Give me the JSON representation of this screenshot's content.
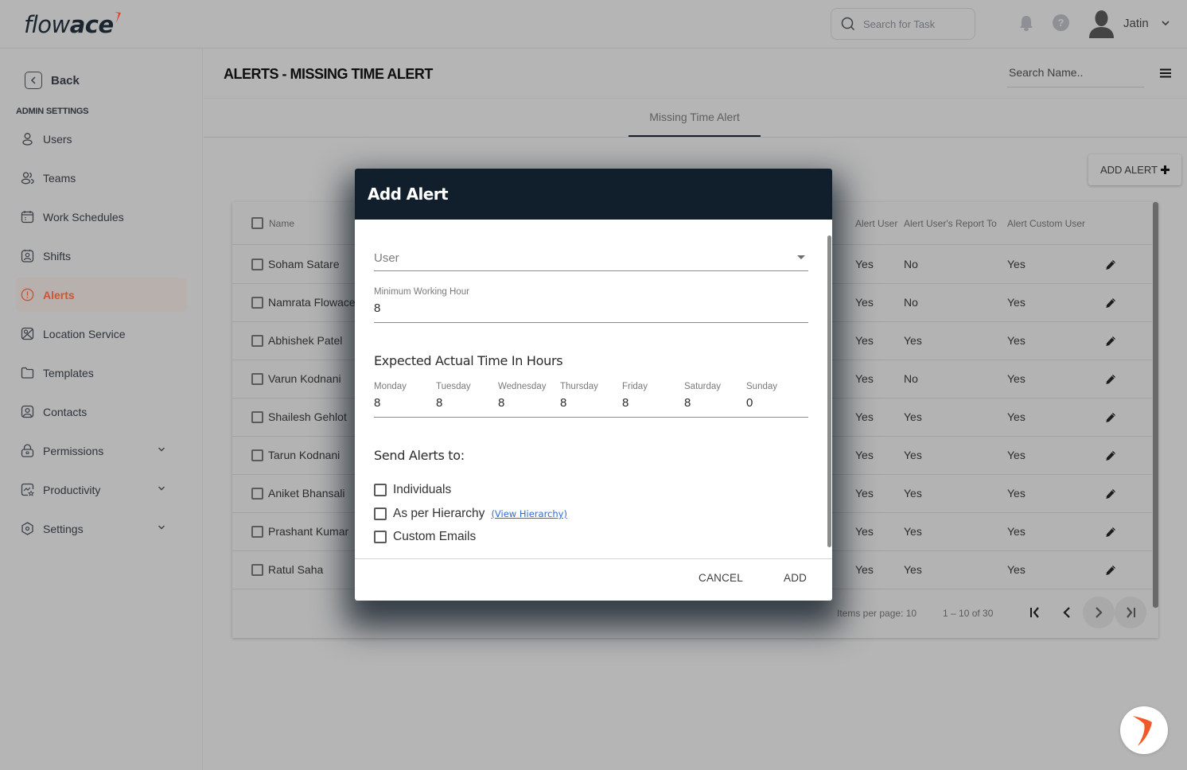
{
  "brand": {
    "logo_light": "flow",
    "logo_bold": "ace",
    "accent": "#e4572e"
  },
  "topbar": {
    "task_search_placeholder": "Search for Task",
    "user_name": "Jatin",
    "help_glyph": "?"
  },
  "sidebar": {
    "back_label": "Back",
    "section_heading": "ADMIN SETTINGS",
    "items": [
      {
        "label": "Users",
        "icon": "user-icon",
        "active": false
      },
      {
        "label": "Teams",
        "icon": "team-icon",
        "active": false
      },
      {
        "label": "Work Schedules",
        "icon": "calendar-icon",
        "active": false
      },
      {
        "label": "Shifts",
        "icon": "shift-badge-icon",
        "active": false
      },
      {
        "label": "Alerts",
        "icon": "alert-circle-icon",
        "active": true
      },
      {
        "label": "Location Service",
        "icon": "map-location-icon",
        "active": false
      },
      {
        "label": "Templates",
        "icon": "folder-icon",
        "active": false
      },
      {
        "label": "Contacts",
        "icon": "contact-icon",
        "active": false
      },
      {
        "label": "Permissions",
        "icon": "lock-icon",
        "active": false,
        "expandable": true
      },
      {
        "label": "Productivity",
        "icon": "productivity-chart-icon",
        "active": false,
        "expandable": true
      },
      {
        "label": "Settings",
        "icon": "settings-hex-icon",
        "active": false,
        "expandable": true
      }
    ]
  },
  "header": {
    "page_title": "ALERTS - MISSING TIME ALERT",
    "name_search_placeholder": "Search Name.."
  },
  "tabs": [
    {
      "label": "Missing Time Alert",
      "active": true
    }
  ],
  "actions": {
    "add_alert_label": "ADD ALERT"
  },
  "table": {
    "columns": [
      "Name",
      "Alert User",
      "Alert User's Report To",
      "Alert Custom User"
    ],
    "rows": [
      {
        "name": "Soham Satare",
        "alert_user": "Yes",
        "report_to": "No",
        "custom_user": "Yes"
      },
      {
        "name": "Namrata Flowace",
        "alert_user": "Yes",
        "report_to": "No",
        "custom_user": "Yes"
      },
      {
        "name": "Abhishek Patel",
        "alert_user": "Yes",
        "report_to": "Yes",
        "custom_user": "Yes"
      },
      {
        "name": "Varun Kodnani",
        "alert_user": "Yes",
        "report_to": "No",
        "custom_user": "Yes"
      },
      {
        "name": "Shailesh Gehlot",
        "alert_user": "Yes",
        "report_to": "Yes",
        "custom_user": "Yes"
      },
      {
        "name": "Tarun Kodnani",
        "alert_user": "Yes",
        "report_to": "Yes",
        "custom_user": "Yes"
      },
      {
        "name": "Aniket Bhansali",
        "alert_user": "Yes",
        "report_to": "Yes",
        "custom_user": "Yes"
      },
      {
        "name": "Prashant Kumar",
        "alert_user": "Yes",
        "report_to": "Yes",
        "custom_user": "Yes"
      },
      {
        "name": "Ratul Saha",
        "alert_user": "Yes",
        "report_to": "Yes",
        "custom_user": "Yes"
      }
    ],
    "paginator": {
      "items_per_page": "Items per page: 10",
      "range": "1 – 10 of 30"
    }
  },
  "modal": {
    "title": "Add Alert",
    "user_placeholder": "User",
    "min_working_hour_label": "Minimum Working Hour",
    "min_working_hour_value": "8",
    "expected_title": "Expected Actual Time In Hours",
    "days": [
      {
        "label": "Monday",
        "value": "8"
      },
      {
        "label": "Tuesday",
        "value": "8"
      },
      {
        "label": "Wednesday",
        "value": "8"
      },
      {
        "label": "Thursday",
        "value": "8"
      },
      {
        "label": "Friday",
        "value": "8"
      },
      {
        "label": "Saturday",
        "value": "8"
      },
      {
        "label": "Sunday",
        "value": "0"
      }
    ],
    "send_alerts_title": "Send Alerts to:",
    "options": [
      {
        "label": "Individuals",
        "checked": false
      },
      {
        "label": "As per Hierarchy",
        "checked": false,
        "link": "(View Hierarchy)"
      },
      {
        "label": "Custom Emails",
        "checked": false
      }
    ],
    "cancel_label": "CANCEL",
    "add_label": "ADD"
  }
}
